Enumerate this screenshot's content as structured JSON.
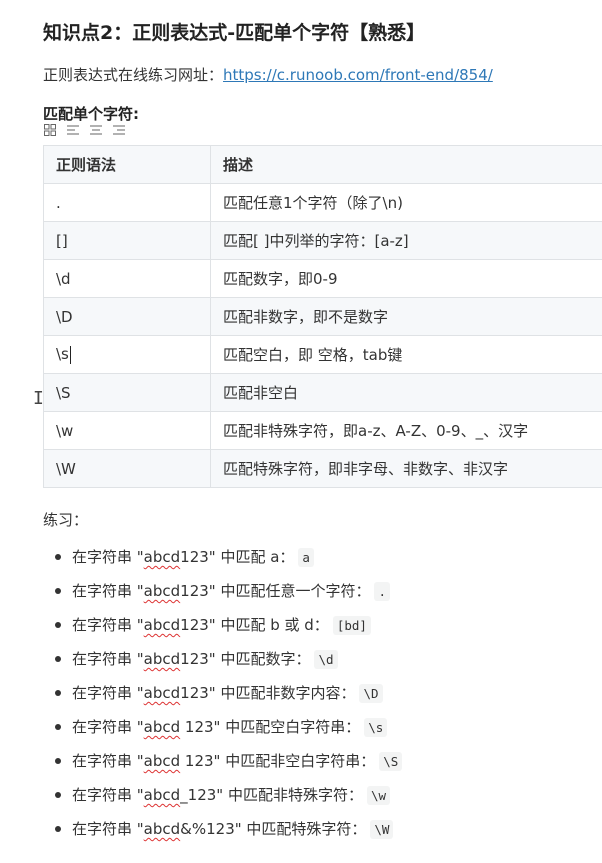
{
  "heading": "知识点2：正则表达式-匹配单个字符【熟悉】",
  "intro": {
    "label": "正则表达式在线练习网址：",
    "link": "https://c.runoob.com/front-end/854/"
  },
  "subheading": "匹配单个字符:",
  "toolbar_icons": [
    "grid-icon",
    "align-left-icon",
    "align-center-icon",
    "align-right-icon"
  ],
  "table": {
    "headers": [
      "正则语法",
      "描述"
    ],
    "rows": [
      [
        ".",
        "匹配任意1个字符（除了\\n)"
      ],
      [
        "[]",
        "匹配[ ]中列举的字符：[a-z]"
      ],
      [
        "\\d",
        "匹配数字，即0-9"
      ],
      [
        "\\D",
        "匹配非数字，即不是数字"
      ],
      [
        "\\s",
        "匹配空白，即 空格，tab键"
      ],
      [
        "\\S",
        "匹配非空白"
      ],
      [
        "\\w",
        "匹配非特殊字符，即a-z、A-Z、0-9、_、汉字"
      ],
      [
        "\\W",
        "匹配特殊字符，即非字母、非数字、非汉字"
      ]
    ]
  },
  "practice_label": "练习：",
  "exercises": [
    {
      "pre": "在字符串 \"",
      "word": "abcd",
      "post": "123\" 中匹配 a：",
      "code": "a"
    },
    {
      "pre": "在字符串 \"",
      "word": "abcd",
      "post": "123\" 中匹配任意一个字符：",
      "code": "."
    },
    {
      "pre": "在字符串 \"",
      "word": "abcd",
      "post": "123\" 中匹配 b 或 d：",
      "code": "[bd]"
    },
    {
      "pre": "在字符串 \"",
      "word": "abcd",
      "post": "123\" 中匹配数字：",
      "code": "\\d"
    },
    {
      "pre": "在字符串 \"",
      "word": "abcd",
      "post": "123\" 中匹配非数字内容：",
      "code": "\\D"
    },
    {
      "pre": "在字符串 \"",
      "word": "abcd",
      "post": " 123\" 中匹配空白字符串：",
      "code": "\\s"
    },
    {
      "pre": "在字符串 \"",
      "word": "abcd",
      "post": " 123\" 中匹配非空白字符串：",
      "code": "\\S"
    },
    {
      "pre": "在字符串 \"",
      "word": "abcd",
      "post": "_123\" 中匹配非特殊字符：",
      "code": "\\w"
    },
    {
      "pre": "在字符串 \"",
      "word": "abcd",
      "post": "&%123\" 中匹配特殊字符：",
      "code": "\\W"
    }
  ]
}
